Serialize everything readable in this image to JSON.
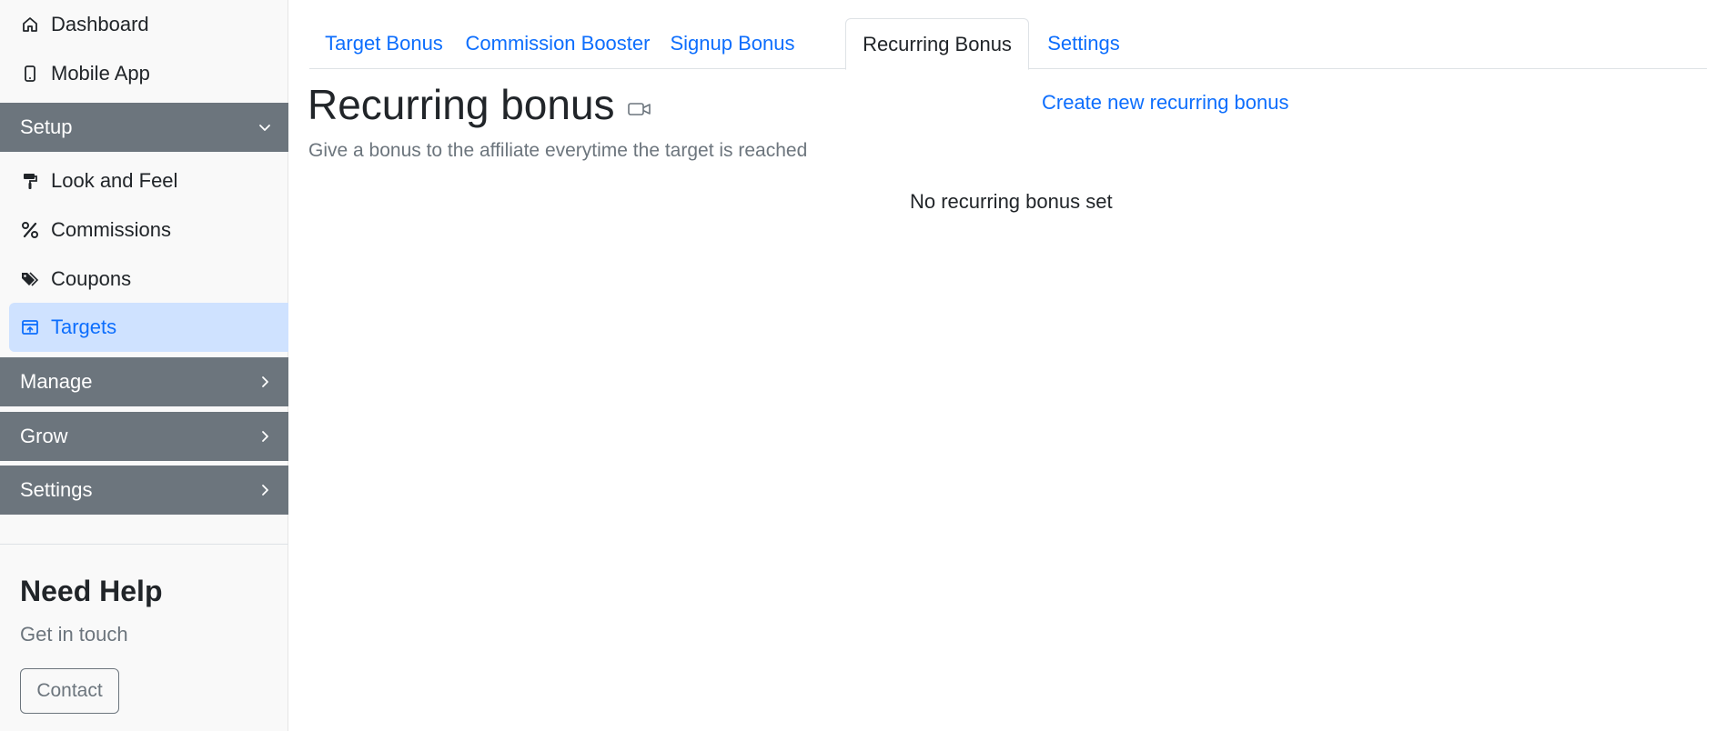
{
  "sidebar": {
    "top_items": [
      {
        "label": "Dashboard",
        "icon": "home-icon"
      },
      {
        "label": "Mobile App",
        "icon": "mobile-icon"
      }
    ],
    "sections": {
      "setup": {
        "label": "Setup",
        "expanded": true,
        "chevron": "chevron-down-icon"
      },
      "manage": {
        "label": "Manage",
        "expanded": false,
        "chevron": "chevron-right-icon"
      },
      "grow": {
        "label": "Grow",
        "expanded": false,
        "chevron": "chevron-right-icon"
      },
      "settings": {
        "label": "Settings",
        "expanded": false,
        "chevron": "chevron-right-icon"
      }
    },
    "setup_items": [
      {
        "label": "Look and Feel",
        "icon": "paint-roller-icon"
      },
      {
        "label": "Commissions",
        "icon": "percent-icon"
      },
      {
        "label": "Coupons",
        "icon": "tags-icon"
      },
      {
        "label": "Targets",
        "icon": "target-board-icon",
        "active": true
      }
    ],
    "help": {
      "title": "Need Help",
      "subtitle": "Get in touch",
      "contact_label": "Contact"
    }
  },
  "tabs": [
    {
      "label": "Target Bonus",
      "active": false
    },
    {
      "label": "Commission Booster",
      "active": false
    },
    {
      "label": "Signup Bonus",
      "active": false
    },
    {
      "label": "Recurring Bonus",
      "active": true
    },
    {
      "label": "Settings",
      "active": false
    }
  ],
  "main": {
    "title": "Recurring bonus",
    "title_icon": "video-camera-icon",
    "create_link": "Create new recurring bonus",
    "subtitle": "Give a bonus to the affiliate everytime the target is reached",
    "empty_message": "No recurring bonus set"
  },
  "colors": {
    "accent": "#0d6efd",
    "active_bg": "#cfe2ff",
    "section_bg": "#6c757d",
    "muted_text": "#6c757d"
  }
}
